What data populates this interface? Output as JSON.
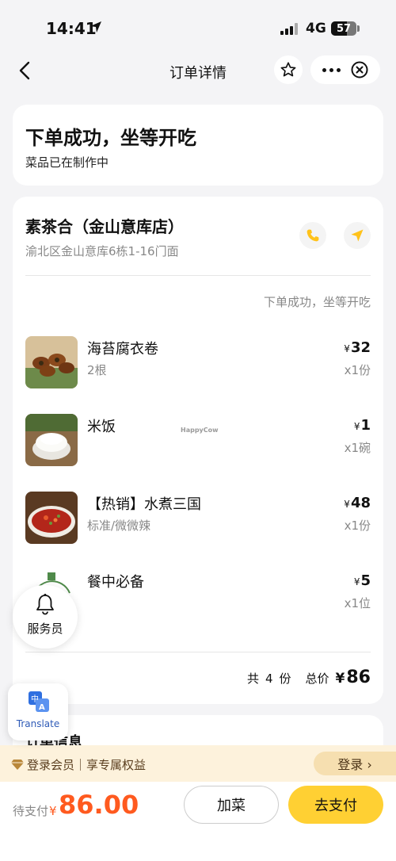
{
  "status_bar": {
    "time": "14:41",
    "network": "4G",
    "battery": "57",
    "icons": [
      "location-arrow-icon",
      "signal-icon",
      "battery-icon"
    ]
  },
  "nav": {
    "title": "订单详情",
    "icons": [
      "back-icon",
      "star-icon",
      "more-icon",
      "close-icon"
    ]
  },
  "status_card": {
    "title": "下单成功，坐等开吃",
    "subtitle": "菜品已在制作中"
  },
  "shop": {
    "name": "素茶合（金山意库店）",
    "address": "渝北区金山意库6栋1-16门面",
    "order_status": "下单成功，坐等开吃",
    "icons": [
      "phone-icon",
      "navigate-icon"
    ]
  },
  "items": [
    {
      "name": "海苔腐衣卷",
      "spec": "2根",
      "currency": "¥",
      "price": "32",
      "qty": "x1份"
    },
    {
      "name": "米饭",
      "spec": "",
      "currency": "¥",
      "price": "1",
      "qty": "x1碗"
    },
    {
      "name": "【热销】水煮三国",
      "spec": "标准/微微辣",
      "currency": "¥",
      "price": "48",
      "qty": "x1份"
    },
    {
      "name": "餐中必备",
      "spec": "",
      "currency": "¥",
      "price": "5",
      "qty": "x1位"
    }
  ],
  "watermark": "HappyCow",
  "summary": {
    "count_prefix": "共",
    "count": "4",
    "count_suffix": "份",
    "total_label": "总价",
    "currency": "¥",
    "total": "86"
  },
  "info_card": {
    "title": "订单信息"
  },
  "member": {
    "text": "登录会员｜享专属权益",
    "login_label": "登录 ›"
  },
  "bottom": {
    "pay_label": "待支付",
    "currency": "¥",
    "amount": "86.00",
    "add_label": "加菜",
    "pay_button_label": "去支付"
  },
  "floating": {
    "waiter_label": "服务员",
    "translate_label": "Translate"
  },
  "colors": {
    "accent_yellow": "#ffd033",
    "price_orange": "#ff5a1f",
    "member_bg": "#fdf2dc",
    "page_bg": "#f4f4f6"
  }
}
